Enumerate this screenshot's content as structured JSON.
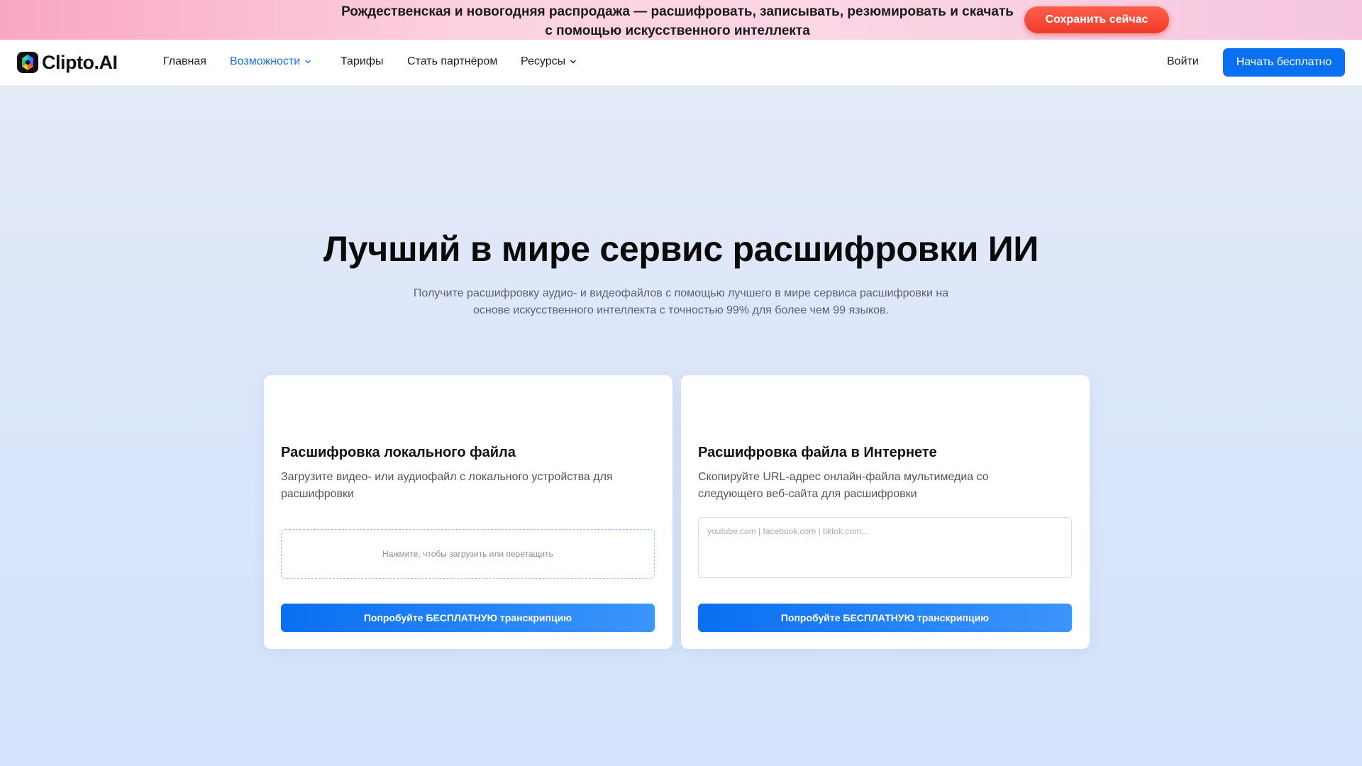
{
  "promo": {
    "text_line1": "Рождественская и новогодняя распродажа — расшифровать, записывать, резюмировать и скачать",
    "text_line2": "с помощью искусственного интеллекта",
    "button_label": "Сохранить сейчас",
    "button_color": "#f03a2b"
  },
  "nav": {
    "logo_text": "Clipto.AI",
    "logo_icon": "clipto-logo-icon",
    "items": [
      {
        "label": "Главная",
        "active": false,
        "has_dropdown": false
      },
      {
        "label": "Возможности",
        "active": true,
        "has_dropdown": true
      },
      {
        "label": "Тарифы",
        "active": false,
        "has_dropdown": false
      },
      {
        "label": "Стать партнёром",
        "active": false,
        "has_dropdown": false
      },
      {
        "label": "Ресурсы",
        "active": false,
        "has_dropdown": true
      }
    ],
    "login_label": "Войти",
    "cta_label": "Начать бесплатно",
    "accent_color": "#0a6ff0",
    "active_color": "#1d6fe6"
  },
  "hero": {
    "title": "Лучший в мире сервис расшифровки ИИ",
    "subtitle": "Получите расшифровку аудио- и видеофайлов с помощью лучшего в мире сервиса расшифровки на основе искусственного интеллекта с точностью 99% для более чем 99 языков."
  },
  "cards": {
    "local": {
      "title": "Расшифровка локального файла",
      "description": "Загрузите видео- или аудиофайл с локального устройства для расшифровки",
      "dropzone_text": "Нажмите, чтобы загрузить или перетащить",
      "button_label": "Попробуйте БЕСПЛАТНУЮ транскрипцию"
    },
    "online": {
      "title": "Расшифровка файла в Интернете",
      "description": "Скопируйте URL-адрес онлайн-файла мультимедиа со следующего веб-сайта для расшифровки",
      "input_placeholder": "youtube.com | facebook.com | tiktok.com...",
      "input_value": "",
      "button_label": "Попробуйте БЕСПЛАТНУЮ транскрипцию"
    }
  }
}
